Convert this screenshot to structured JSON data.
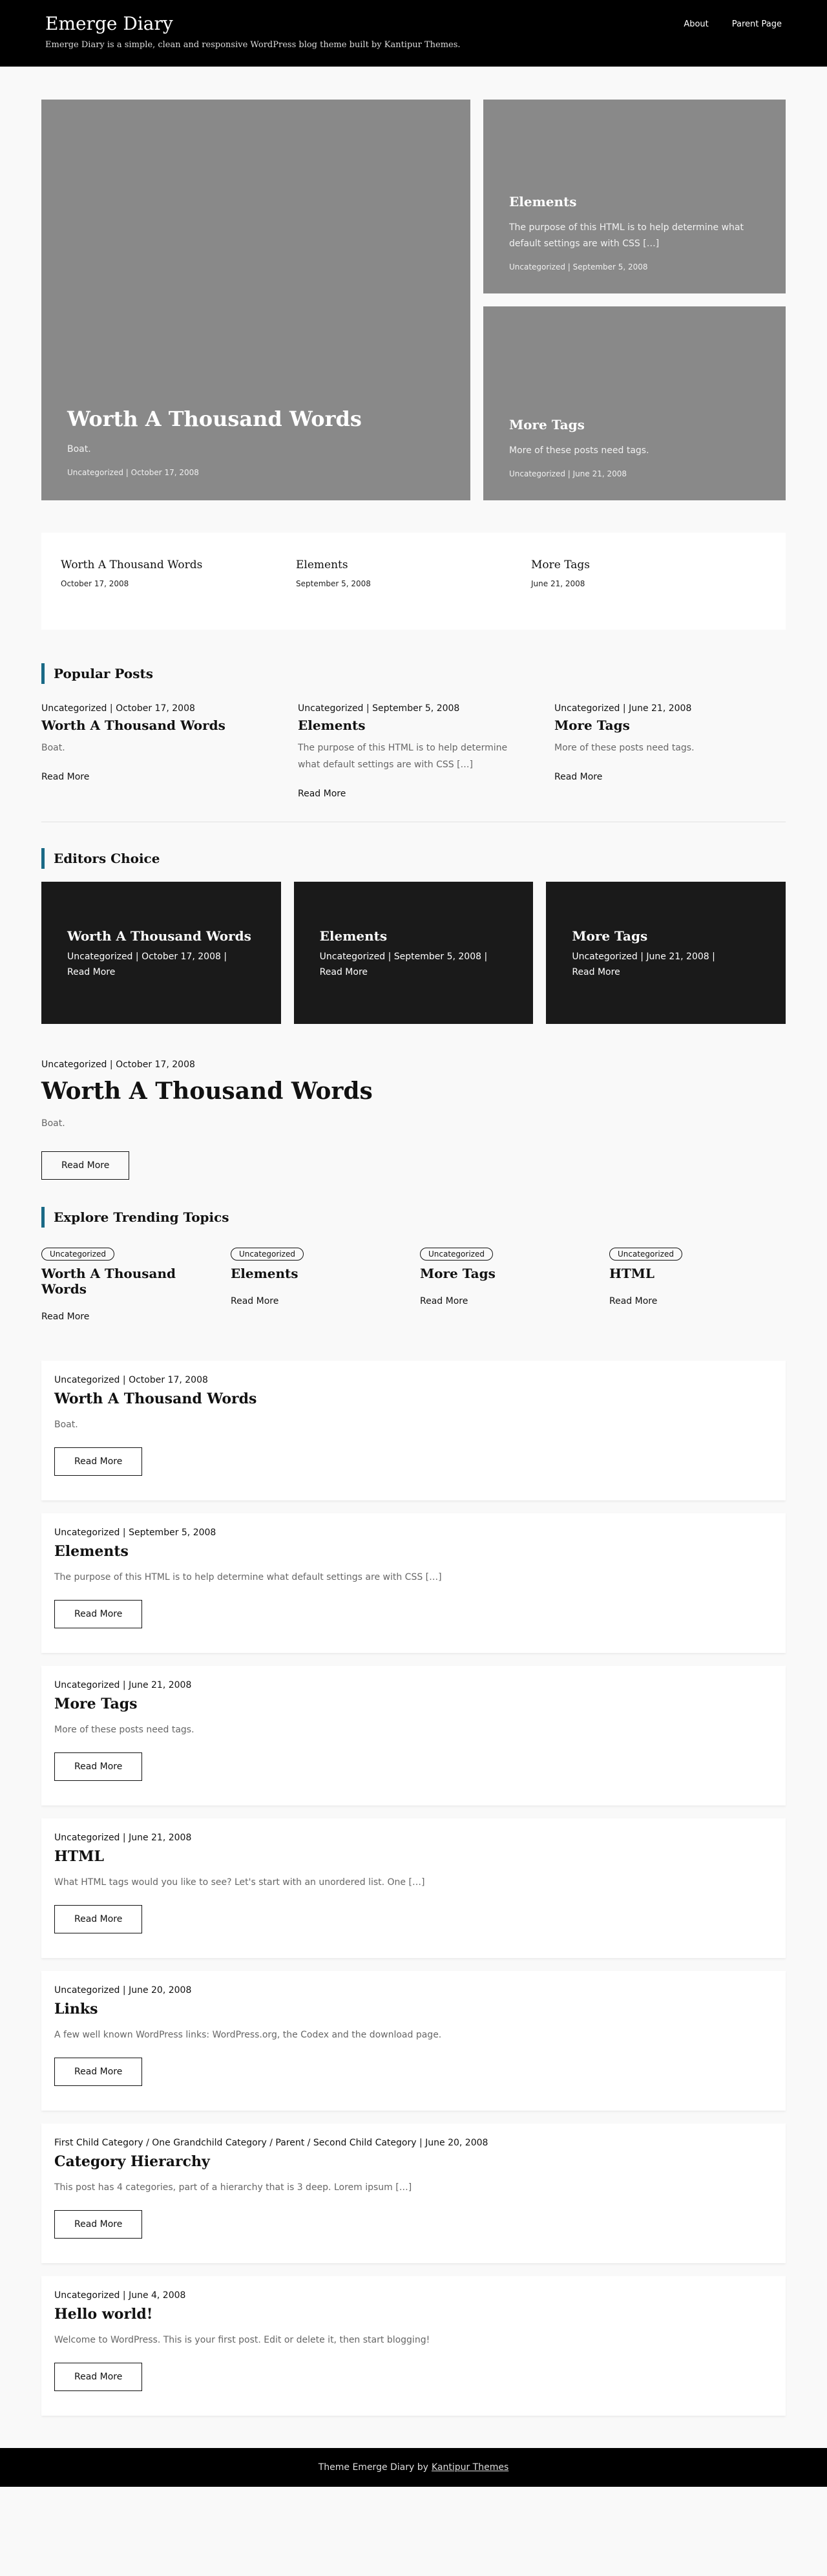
{
  "site": {
    "title": "Emerge Diary",
    "description": "Emerge Diary is a simple, clean and responsive WordPress blog theme built by Kantipur Themes."
  },
  "nav": [
    "About",
    "Parent Page"
  ],
  "hero": {
    "big": {
      "title": "Worth A Thousand Words",
      "excerpt": "Boat.",
      "meta": "Uncategorized | October 17, 2008"
    },
    "small": [
      {
        "title": "Elements",
        "excerpt": "The purpose of this HTML is to help determine what default settings are with CSS […]",
        "meta": "Uncategorized | September 5, 2008"
      },
      {
        "title": "More Tags",
        "excerpt": "More of these posts need tags.",
        "meta": "Uncategorized | June 21, 2008"
      }
    ]
  },
  "recent": [
    {
      "title": "Worth A Thousand Words",
      "date": "October 17, 2008"
    },
    {
      "title": "Elements",
      "date": "September 5, 2008"
    },
    {
      "title": "More Tags",
      "date": "June 21, 2008"
    }
  ],
  "popular": {
    "heading": "Popular Posts",
    "items": [
      {
        "meta": "Uncategorized | October 17, 2008",
        "title": "Worth A Thousand Words",
        "excerpt": "Boat.",
        "read_more": "Read More"
      },
      {
        "meta": "Uncategorized | September 5, 2008",
        "title": "Elements",
        "excerpt": "The purpose of this HTML is to help determine what default settings are with CSS […]",
        "read_more": "Read More"
      },
      {
        "meta": "Uncategorized | June 21, 2008",
        "title": "More Tags",
        "excerpt": "More of these posts need tags.",
        "read_more": "Read More"
      }
    ]
  },
  "editors": {
    "heading": "Editors Choice",
    "items": [
      {
        "title": "Worth A Thousand Words",
        "meta": "Uncategorized | October 17, 2008 |",
        "read_more": "Read More"
      },
      {
        "title": "Elements",
        "meta": "Uncategorized | September 5, 2008 |",
        "read_more": "Read More"
      },
      {
        "title": "More Tags",
        "meta": "Uncategorized | June 21, 2008 |",
        "read_more": "Read More"
      }
    ]
  },
  "featured": {
    "meta": "Uncategorized | October 17, 2008",
    "title": "Worth A Thousand Words",
    "excerpt": "Boat.",
    "button": "Read More"
  },
  "trending": {
    "heading": "Explore Trending Topics",
    "items": [
      {
        "badge": "Uncategorized",
        "title": "Worth A Thousand Words",
        "read_more": "Read More"
      },
      {
        "badge": "Uncategorized",
        "title": "Elements",
        "read_more": "Read More"
      },
      {
        "badge": "Uncategorized",
        "title": "More Tags",
        "read_more": "Read More"
      },
      {
        "badge": "Uncategorized",
        "title": "HTML",
        "read_more": "Read More"
      }
    ]
  },
  "posts": [
    {
      "meta": "Uncategorized | October 17, 2008",
      "title": "Worth A Thousand Words",
      "excerpt": "Boat.",
      "button": "Read More"
    },
    {
      "meta": "Uncategorized | September 5, 2008",
      "title": "Elements",
      "excerpt": "The purpose of this HTML is to help determine what default settings are with CSS […]",
      "button": "Read More"
    },
    {
      "meta": "Uncategorized | June 21, 2008",
      "title": "More Tags",
      "excerpt": "More of these posts need tags.",
      "button": "Read More"
    },
    {
      "meta": "Uncategorized | June 21, 2008",
      "title": "HTML",
      "excerpt": "What HTML tags would you like to see? Let's start with an unordered list. One […]",
      "button": "Read More"
    },
    {
      "meta": "Uncategorized | June 20, 2008",
      "title": "Links",
      "excerpt": "A few well known WordPress links: WordPress.org, the Codex and the download page.",
      "button": "Read More"
    },
    {
      "meta": "First Child Category / One Grandchild Category / Parent / Second Child Category | June 20, 2008",
      "title": "Category Hierarchy",
      "excerpt": "This post has 4 categories, part of a hierarchy that is 3 deep. Lorem ipsum […]",
      "button": "Read More"
    },
    {
      "meta": "Uncategorized | June 4, 2008",
      "title": "Hello world!",
      "excerpt": "Welcome to WordPress. This is your first post. Edit or delete it, then start blogging!",
      "button": "Read More"
    }
  ],
  "footer": {
    "text": "Theme Emerge Diary by",
    "link": "Kantipur Themes"
  },
  "colors": {
    "accent": "#1a6a86",
    "header_bg": "#000000",
    "hero_bg": "#898989",
    "card_dark": "#1a1a1a"
  }
}
